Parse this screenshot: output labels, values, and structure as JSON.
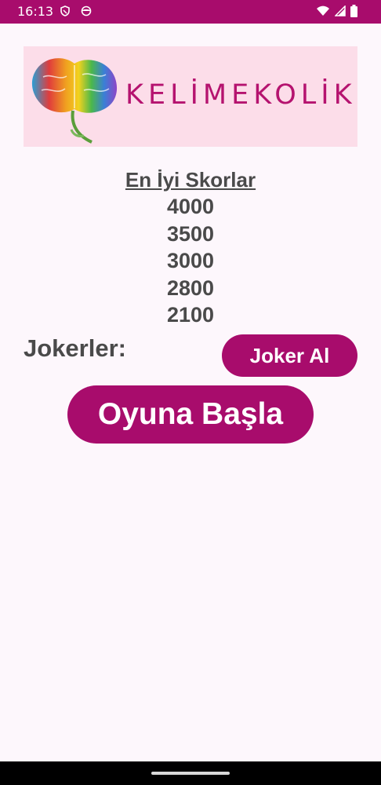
{
  "status_bar": {
    "time": "16:13",
    "left_icons": [
      "shield-icon",
      "face-icon"
    ],
    "right_icons": [
      "wifi-icon",
      "signal-icon",
      "battery-icon"
    ]
  },
  "logo": {
    "text": "KELİMEKOLİK",
    "icon": "rainbow-brain-icon"
  },
  "scores": {
    "title": "En İyi Skorlar",
    "items": [
      "4000",
      "3500",
      "3000",
      "2800",
      "2100"
    ]
  },
  "jokers": {
    "label": "Jokerler:",
    "button_label": "Joker Al"
  },
  "start": {
    "button_label": "Oyuna Başla"
  },
  "colors": {
    "primary": "#a80c6c",
    "logo_bg": "#fcdde9",
    "text": "#4a4a4a",
    "background": "#fdf7fc"
  }
}
